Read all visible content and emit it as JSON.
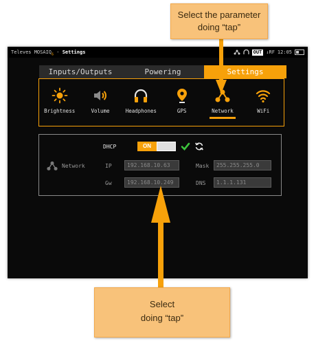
{
  "statusbar": {
    "device": "Televes MOSAIQ",
    "device_suffix": "6",
    "separator": " - ",
    "screen_title": "Settings",
    "out_badge": "OUT",
    "rf_label": "↓RF",
    "time": "12:05"
  },
  "tabs": [
    {
      "label": "Inputs/Outputs",
      "active": false
    },
    {
      "label": "Powering",
      "active": false
    },
    {
      "label": "Settings",
      "active": true
    }
  ],
  "settings_icons": [
    {
      "icon": "brightness-icon",
      "label": "Brightness"
    },
    {
      "icon": "volume-icon",
      "label": "Volume"
    },
    {
      "icon": "headphones-icon",
      "label": "Headphones"
    },
    {
      "icon": "gps-icon",
      "label": "GPS"
    },
    {
      "icon": "network-icon",
      "label": "Network",
      "selected": true
    },
    {
      "icon": "wifi-icon",
      "label": "WiFi"
    }
  ],
  "network": {
    "section_label": "Network",
    "dhcp_label": "DHCP",
    "dhcp_value": "ON",
    "ip_label": "IP",
    "ip_value": "192.168.10.63",
    "mask_label": "Mask",
    "mask_value": "255.255.255.0",
    "gw_label": "Gw",
    "gw_value": "192.168.10.249",
    "dns_label": "DNS",
    "dns_value": "1.1.1.131"
  },
  "callouts": {
    "top_line1": "Select the parameter",
    "top_line2": "doing “tap”",
    "bottom_line1": "Select",
    "bottom_line2": "doing “tap”"
  },
  "colors": {
    "accent": "#f7a10a",
    "callout_bg": "#f8c27a",
    "screen_bg": "#0a0a0a"
  }
}
